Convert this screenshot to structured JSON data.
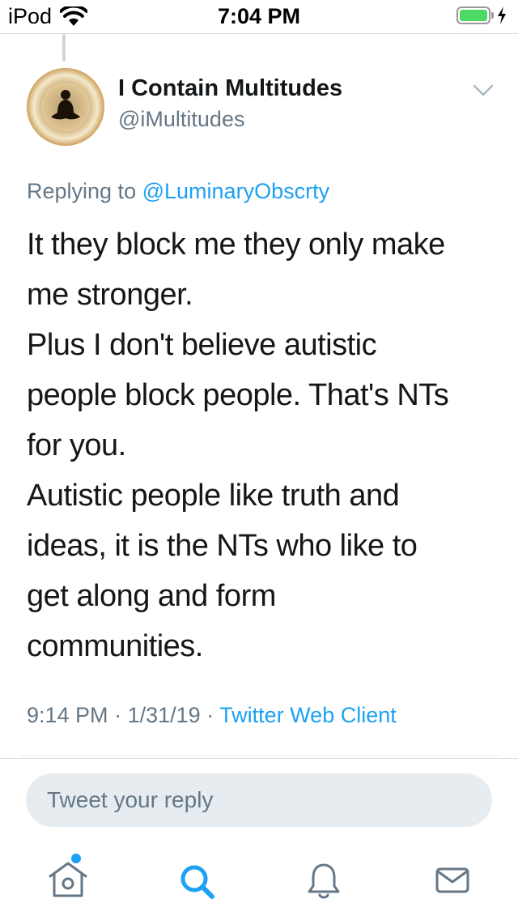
{
  "status_bar": {
    "carrier": "iPod",
    "time": "7:04 PM",
    "battery_color": "#4cd964"
  },
  "tweet": {
    "author": {
      "display_name": "I Contain Multitudes",
      "handle": "@iMultitudes"
    },
    "replying_prefix": "Replying to",
    "replying_to": "@LuminaryObscrty",
    "text_lines": [
      "It they block me they only make",
      "me stronger.",
      "Plus I don't believe autistic",
      "people block people. That's NTs",
      "for you.",
      "Autistic people like truth and",
      "ideas, it is the NTs who like to",
      "get along and form",
      "communities."
    ],
    "time": "9:14 PM",
    "separator": " · ",
    "date": "1/31/19",
    "client": "Twitter Web Client"
  },
  "reply": {
    "placeholder": "Tweet your reply"
  },
  "tab_bar": {
    "items": [
      "home-icon",
      "search-icon",
      "notifications-icon",
      "messages-icon"
    ],
    "accent_color": "#1da1f2"
  }
}
